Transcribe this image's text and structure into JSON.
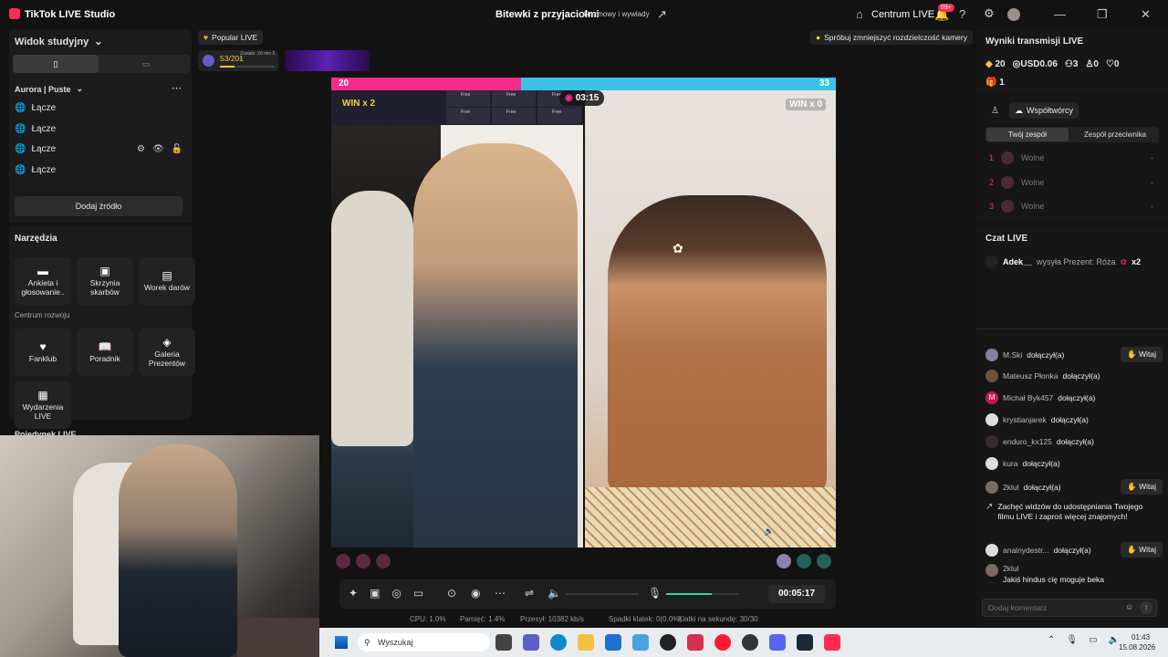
{
  "app": {
    "title": "TikTok LIVE Studio"
  },
  "header": {
    "stream_title": "Bitewki z przyjaciolmi",
    "category": "Rozmowy i wywiady",
    "centrum": "Centrum LIVE",
    "notif_badge": "99+"
  },
  "left": {
    "view_label": "Widok studyjny",
    "scene": "Aurora | Puste",
    "sources": [
      "Łącze",
      "Łącze",
      "Łącze",
      "Łącze"
    ],
    "add_source": "Dodaj źródło",
    "tools_title": "Narzędzia",
    "tools": [
      "Ankieta i głosowanie..",
      "Skrzynia skarbów",
      "Worek darów"
    ],
    "growth_title": "Centrum rozwoju",
    "growth": [
      "Fanklub",
      "Poradnik",
      "Galeria Prezentów"
    ],
    "events": "Wydarzenia LIVE",
    "duel": "Pojedynek LIVE"
  },
  "stage": {
    "popular": "Popular LIVE",
    "progress": "53/201",
    "progress_fraction": 0.26,
    "banner_note": "Zostało: 20 min 5 s",
    "hint": "Spróbuj zmniejszyć rozdzielczość kamery",
    "score_left": "20",
    "score_right": "33",
    "score_left_share": 0.377,
    "timer": "03:15",
    "win_left": "WIN x 2",
    "win_right": "WIN x 0",
    "free": "Free",
    "elapsed": "00:05:17",
    "mic_level": 0.62
  },
  "stats": {
    "cpu": "CPU: 1.0%",
    "mem": "Pamięć: 1.4%",
    "bitrate": "Przesył: 10382 kb/s",
    "drops": "Spadki klatek: 0(0.0%)",
    "fps": "Klatki na sekundę: 30/30"
  },
  "right": {
    "results_title": "Wyniki transmisji LIVE",
    "diamonds": "20",
    "usd": "USD0.06",
    "viewers": "3",
    "follows": "0",
    "likes": "0",
    "gifts": "1",
    "cohosts": "Współtwórcy",
    "tab_mine": "Twój zespół",
    "tab_opp": "Zespół przeciwnika",
    "slots": [
      {
        "n": "1",
        "label": "Wolne",
        "val": "-"
      },
      {
        "n": "2",
        "label": "Wolne",
        "val": "-"
      },
      {
        "n": "3",
        "label": "Wolne",
        "val": "-"
      }
    ],
    "chat_title": "Czat LIVE",
    "gift_user": "Adek__",
    "gift_text": "wysyła Prezent: Róża",
    "gift_count": "x2",
    "chat": [
      {
        "name": "M.Ski",
        "text": "dołączył(a)",
        "witaj": "Witaj"
      },
      {
        "name": "Mateusz Płonka",
        "text": "dołączył(a)",
        "witaj": ""
      },
      {
        "name": "Michał Byk457",
        "text": "dołączył(a)",
        "witaj": ""
      },
      {
        "name": "krystianjarek",
        "text": "dołączył(a)",
        "witaj": ""
      },
      {
        "name": "enduro_kx125",
        "text": "dołączył(a)",
        "witaj": ""
      },
      {
        "name": "kura",
        "text": "dołączył(a)",
        "witaj": ""
      },
      {
        "name": "2klul",
        "text": "dołączył(a)",
        "witaj": "Witaj"
      }
    ],
    "share_prompt": "Zachęć widzów do udostępniania Twojego filmu LIVE i zaproś więcej znajomych!",
    "last_join": {
      "name": "analnydestr...",
      "text": "dołączył(a)",
      "witaj": "Witaj"
    },
    "last_msg": {
      "name": "2klul",
      "text": "Jakiś hindus cię moguje beka"
    },
    "comment_placeholder": "Dodaj komentarz"
  },
  "taskbar": {
    "search": "Wyszukaj",
    "time": "01:43",
    "date": "15.08.2026"
  },
  "colors": {
    "accent": "#fe2c55",
    "score_left": "#f72b8c",
    "score_right": "#3ac3e6",
    "mic": "#2ed69f"
  }
}
